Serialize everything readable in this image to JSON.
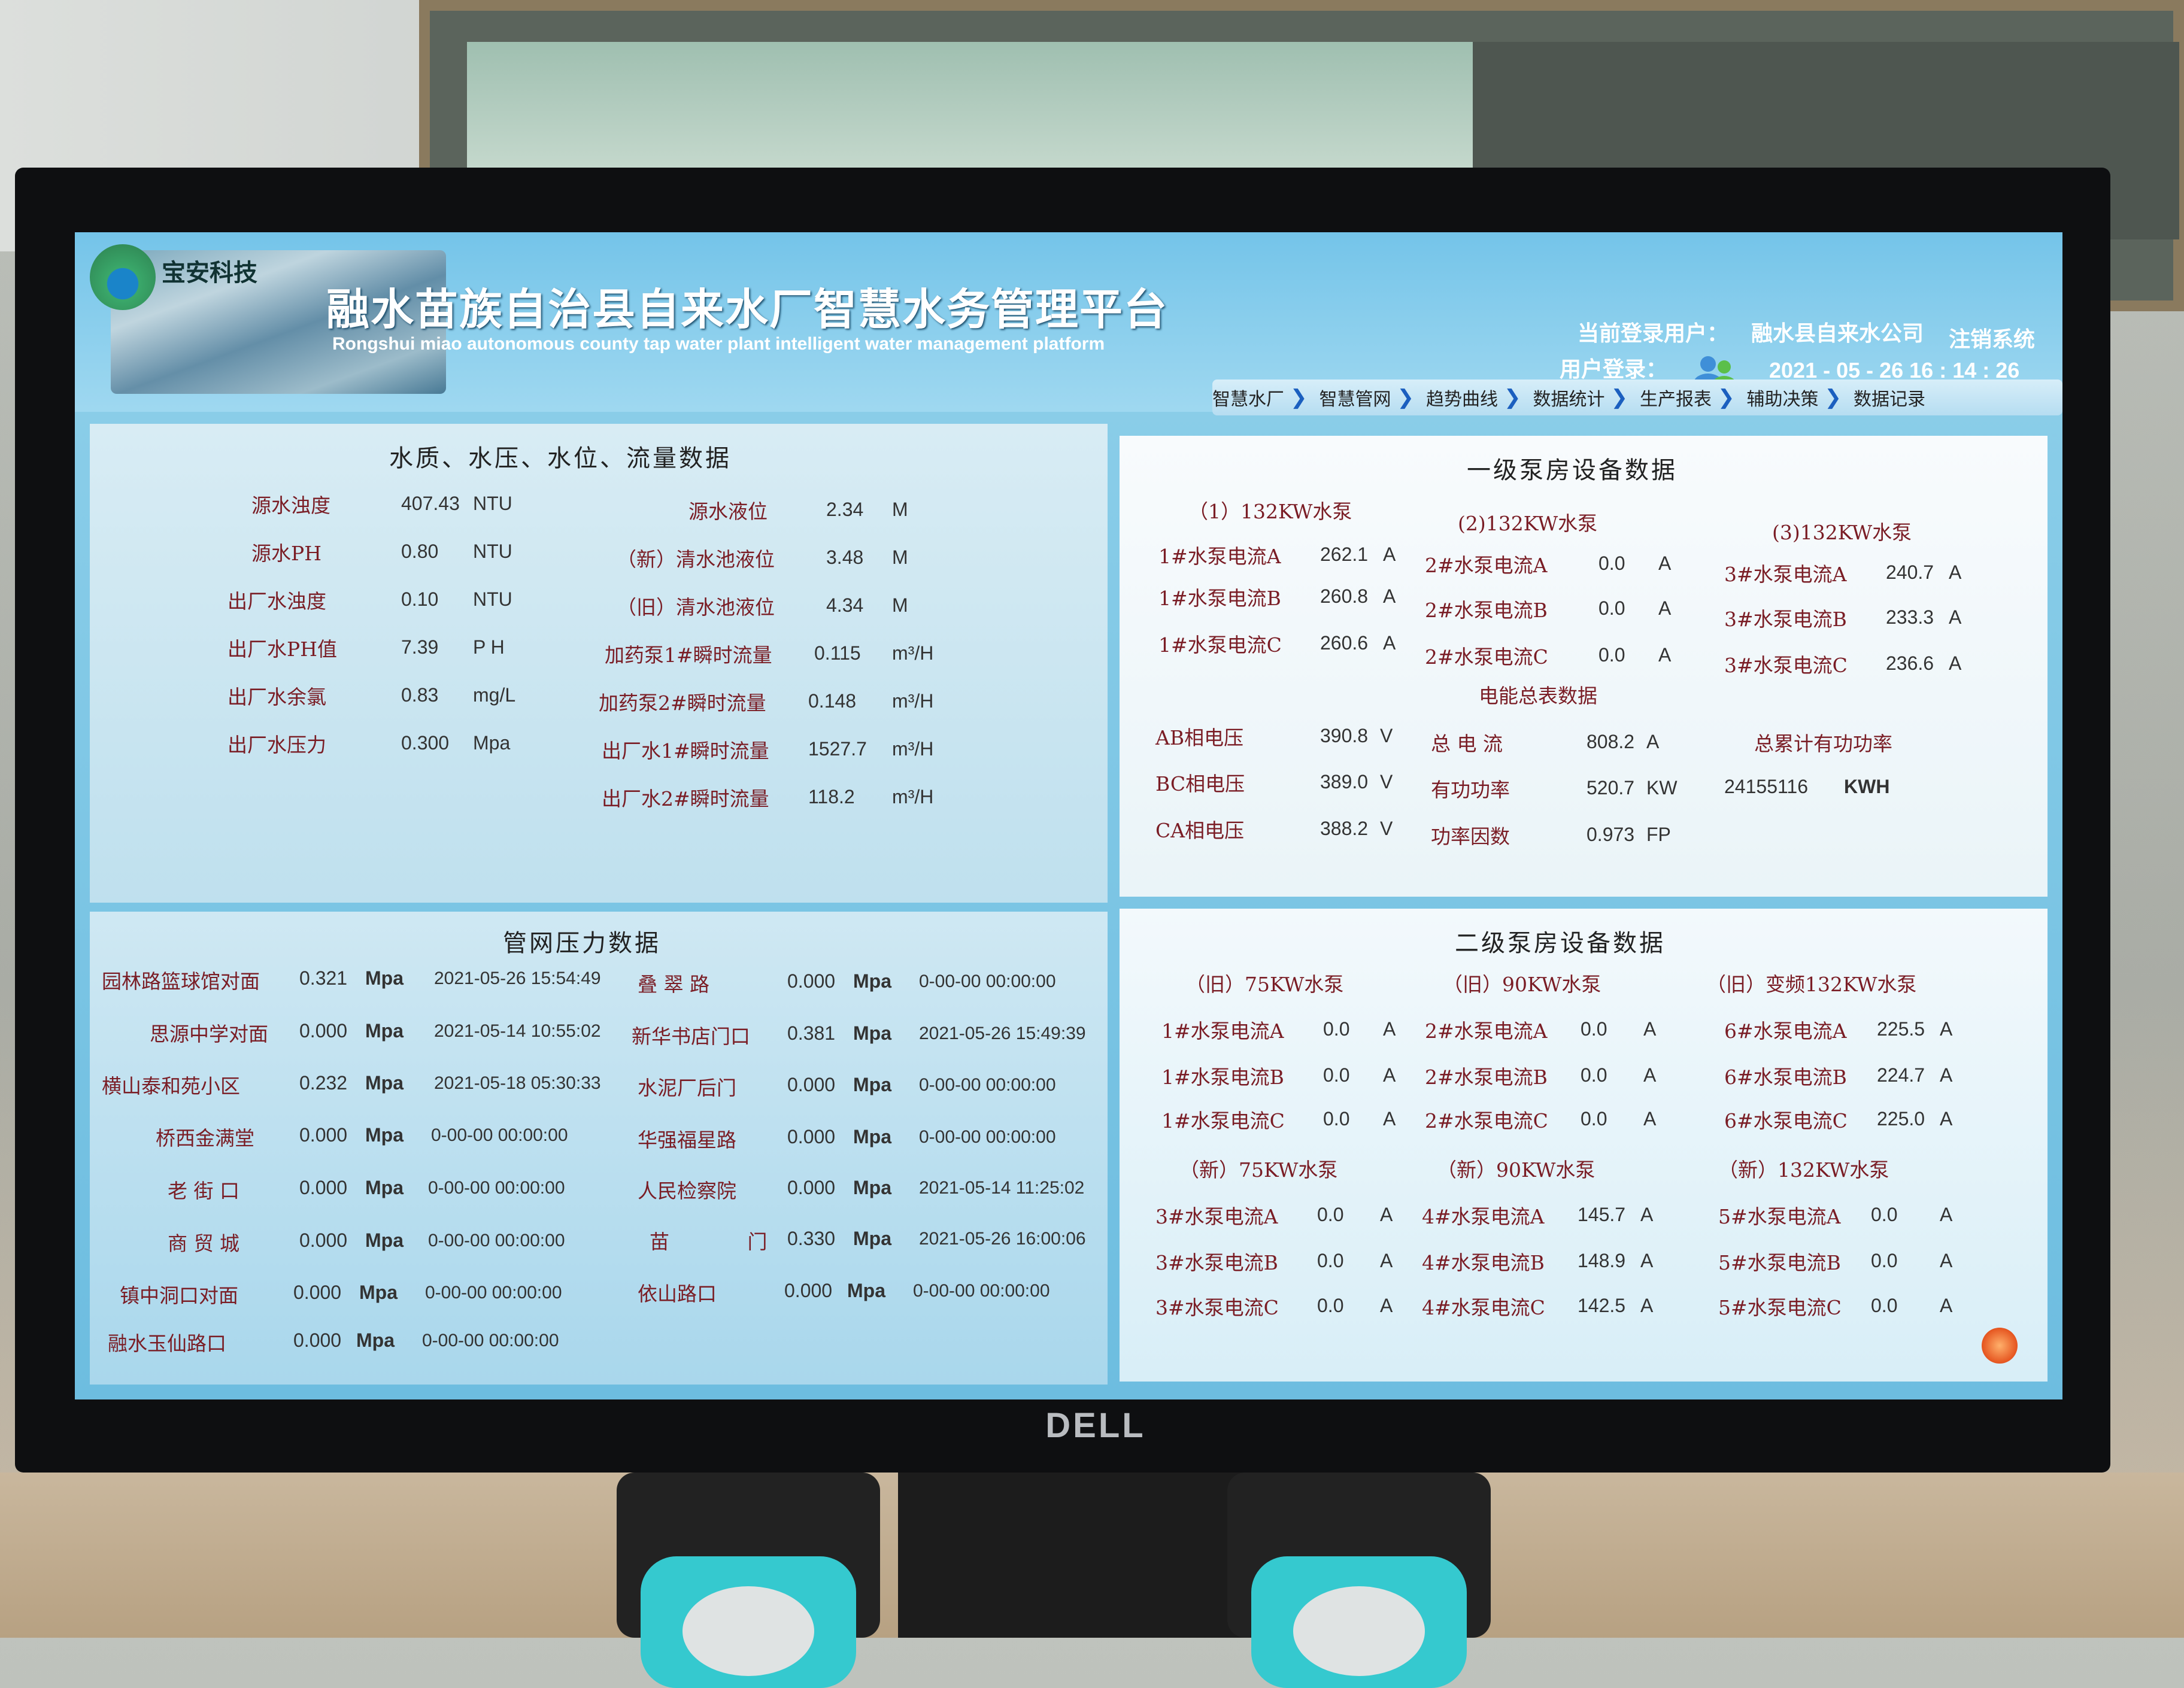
{
  "header": {
    "logo_text": "宝安科技",
    "title": "融水苗族自治县自来水厂智慧水务管理平台",
    "subtitle": "Rongshui miao autonomous county tap water plant intelligent water management platform",
    "current_user_label": "当前登录用户：",
    "current_user": "融水县自来水公司",
    "logout": "注销系统",
    "user_login_label": "用户登录：",
    "datetime": "2021 - 05 - 26   16 : 14 : 26"
  },
  "nav": [
    "智慧水厂",
    "智慧管网",
    "趋势曲线",
    "数据统计",
    "生产报表",
    "辅助决策",
    "数据记录"
  ],
  "quality": {
    "title": "水质、水压、水位、流量数据",
    "left": [
      {
        "label": "源水浊度",
        "value": "407.43",
        "unit": "NTU"
      },
      {
        "label": "源水PH",
        "value": "0.80",
        "unit": "NTU"
      },
      {
        "label": "出厂水浊度",
        "value": "0.10",
        "unit": "NTU"
      },
      {
        "label": "出厂水PH值",
        "value": "7.39",
        "unit": "P H"
      },
      {
        "label": "出厂水余氯",
        "value": "0.83",
        "unit": "mg/L"
      },
      {
        "label": "出厂水压力",
        "value": "0.300",
        "unit": "Mpa"
      }
    ],
    "right": [
      {
        "label": "源水液位",
        "value": "2.34",
        "unit": "M"
      },
      {
        "label": "（新）清水池液位",
        "value": "3.48",
        "unit": "M"
      },
      {
        "label": "（旧）清水池液位",
        "value": "4.34",
        "unit": "M"
      },
      {
        "label": "加药泵1#瞬时流量",
        "value": "0.115",
        "unit": "m³/H"
      },
      {
        "label": "加药泵2#瞬时流量",
        "value": "0.148",
        "unit": "m³/H"
      },
      {
        "label": "出厂水1#瞬时流量",
        "value": "1527.7",
        "unit": "m³/H"
      },
      {
        "label": "出厂水2#瞬时流量",
        "value": "118.2",
        "unit": "m³/H"
      }
    ]
  },
  "pipe": {
    "title": "管网压力数据",
    "left": [
      {
        "label": "园林路篮球馆对面",
        "value": "0.321",
        "unit": "Mpa",
        "time": "2021-05-26 15:54:49"
      },
      {
        "label": "思源中学对面",
        "value": "0.000",
        "unit": "Mpa",
        "time": "2021-05-14 10:55:02"
      },
      {
        "label": "横山泰和苑小区",
        "value": "0.232",
        "unit": "Mpa",
        "time": "2021-05-18 05:30:33"
      },
      {
        "label": "桥西金满堂",
        "value": "0.000",
        "unit": "Mpa",
        "time": "0-00-00 00:00:00"
      },
      {
        "label": "老 街 口",
        "value": "0.000",
        "unit": "Mpa",
        "time": "0-00-00 00:00:00"
      },
      {
        "label": "商 贸 城",
        "value": "0.000",
        "unit": "Mpa",
        "time": "0-00-00 00:00:00"
      },
      {
        "label": "镇中洞口对面",
        "value": "0.000",
        "unit": "Mpa",
        "time": "0-00-00 00:00:00"
      },
      {
        "label": "融水玉仙路口",
        "value": "0.000",
        "unit": "Mpa",
        "time": "0-00-00 00:00:00"
      }
    ],
    "right": [
      {
        "label": "叠 翠 路",
        "value": "0.000",
        "unit": "Mpa",
        "time": "0-00-00 00:00:00"
      },
      {
        "label": "新华书店门口",
        "value": "0.381",
        "unit": "Mpa",
        "time": "2021-05-26 15:49:39"
      },
      {
        "label": "水泥厂后门",
        "value": "0.000",
        "unit": "Mpa",
        "time": "0-00-00 00:00:00"
      },
      {
        "label": "华强福星路",
        "value": "0.000",
        "unit": "Mpa",
        "time": "0-00-00 00:00:00"
      },
      {
        "label": "人民检察院",
        "value": "0.000",
        "unit": "Mpa",
        "time": "2021-05-14 11:25:02"
      },
      {
        "label": "苗 门",
        "value": "0.330",
        "unit": "Mpa",
        "time": "2021-05-26 16:00:06"
      },
      {
        "label": "依山路口",
        "value": "0.000",
        "unit": "Mpa",
        "time": "0-00-00 00:00:00"
      }
    ]
  },
  "pump1": {
    "title": "一级泵房设备数据",
    "groups": [
      {
        "name": "（1）132KW水泵",
        "rows": [
          {
            "label": "1#水泵电流A",
            "value": "262.1",
            "unit": "A"
          },
          {
            "label": "1#水泵电流B",
            "value": "260.8",
            "unit": "A"
          },
          {
            "label": "1#水泵电流C",
            "value": "260.6",
            "unit": "A"
          }
        ]
      },
      {
        "name": "(2)132KW水泵",
        "rows": [
          {
            "label": "2#水泵电流A",
            "value": "0.0",
            "unit": "A"
          },
          {
            "label": "2#水泵电流B",
            "value": "0.0",
            "unit": "A"
          },
          {
            "label": "2#水泵电流C",
            "value": "0.0",
            "unit": "A"
          }
        ]
      },
      {
        "name": "(3)132KW水泵",
        "rows": [
          {
            "label": "3#水泵电流A",
            "value": "240.7",
            "unit": "A"
          },
          {
            "label": "3#水泵电流B",
            "value": "233.3",
            "unit": "A"
          },
          {
            "label": "3#水泵电流C",
            "value": "236.6",
            "unit": "A"
          }
        ]
      }
    ],
    "energy_title": "电能总表数据",
    "voltages": [
      {
        "label": "AB相电压",
        "value": "390.8",
        "unit": "V"
      },
      {
        "label": "BC相电压",
        "value": "389.0",
        "unit": "V"
      },
      {
        "label": "CA相电压",
        "value": "388.2",
        "unit": "V"
      }
    ],
    "power": [
      {
        "label": "总 电 流",
        "value": "808.2",
        "unit": "A"
      },
      {
        "label": "有功功率",
        "value": "520.7",
        "unit": "KW"
      },
      {
        "label": "功率因数",
        "value": "0.973",
        "unit": "FP"
      }
    ],
    "total_label": "总累计有功功率",
    "total_value": "24155116",
    "total_unit": "KWH"
  },
  "pump2": {
    "title": "二级泵房设备数据",
    "groups": [
      {
        "name": "（旧）75KW水泵",
        "rows": [
          {
            "label": "1#水泵电流A",
            "value": "0.0",
            "unit": "A"
          },
          {
            "label": "1#水泵电流B",
            "value": "0.0",
            "unit": "A"
          },
          {
            "label": "1#水泵电流C",
            "value": "0.0",
            "unit": "A"
          }
        ]
      },
      {
        "name": "（旧）90KW水泵",
        "rows": [
          {
            "label": "2#水泵电流A",
            "value": "0.0",
            "unit": "A"
          },
          {
            "label": "2#水泵电流B",
            "value": "0.0",
            "unit": "A"
          },
          {
            "label": "2#水泵电流C",
            "value": "0.0",
            "unit": "A"
          }
        ]
      },
      {
        "name": "（旧）变频132KW水泵",
        "rows": [
          {
            "label": "6#水泵电流A",
            "value": "225.5",
            "unit": "A"
          },
          {
            "label": "6#水泵电流B",
            "value": "224.7",
            "unit": "A"
          },
          {
            "label": "6#水泵电流C",
            "value": "225.0",
            "unit": "A"
          }
        ]
      },
      {
        "name": "（新）75KW水泵",
        "rows": [
          {
            "label": "3#水泵电流A",
            "value": "0.0",
            "unit": "A"
          },
          {
            "label": "3#水泵电流B",
            "value": "0.0",
            "unit": "A"
          },
          {
            "label": "3#水泵电流C",
            "value": "0.0",
            "unit": "A"
          }
        ]
      },
      {
        "name": "（新）90KW水泵",
        "rows": [
          {
            "label": "4#水泵电流A",
            "value": "145.7",
            "unit": "A"
          },
          {
            "label": "4#水泵电流B",
            "value": "148.9",
            "unit": "A"
          },
          {
            "label": "4#水泵电流C",
            "value": "142.5",
            "unit": "A"
          }
        ]
      },
      {
        "name": "（新）132KW水泵",
        "rows": [
          {
            "label": "5#水泵电流A",
            "value": "0.0",
            "unit": "A"
          },
          {
            "label": "5#水泵电流B",
            "value": "0.0",
            "unit": "A"
          },
          {
            "label": "5#水泵电流C",
            "value": "0.0",
            "unit": "A"
          }
        ]
      }
    ]
  },
  "monitor_brand": "DELL"
}
